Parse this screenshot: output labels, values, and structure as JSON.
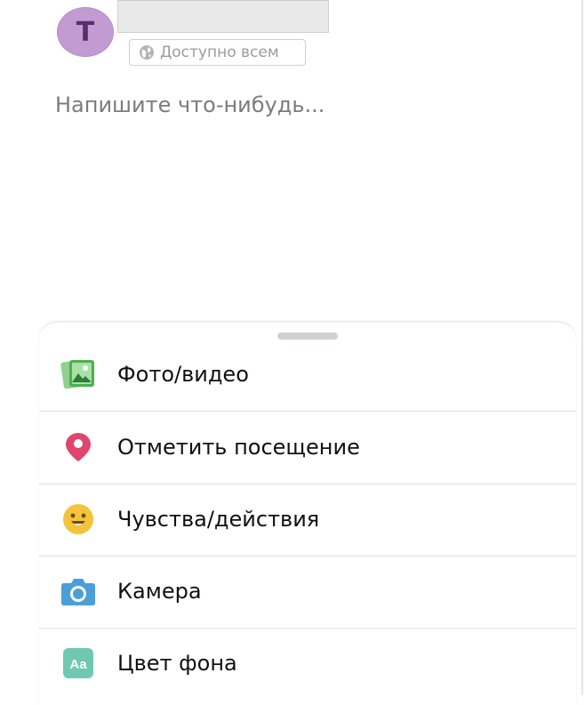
{
  "composer": {
    "avatar_initial": "T",
    "privacy_label": "Доступно всем",
    "text_placeholder": "Напишите что-нибудь..."
  },
  "sheet": {
    "items": [
      {
        "label": "Фото/видео",
        "icon": "photo-video-icon",
        "color": "#5cb85c"
      },
      {
        "label": "Отметить посещение",
        "icon": "location-pin-icon",
        "color": "#e0466d"
      },
      {
        "label": "Чувства/действия",
        "icon": "smiley-icon",
        "color": "#f5c33b"
      },
      {
        "label": "Камера",
        "icon": "camera-icon",
        "color": "#4a9fd8"
      },
      {
        "label": "Цвет фона",
        "icon": "background-color-icon",
        "color": "#6ec9b0"
      }
    ]
  }
}
